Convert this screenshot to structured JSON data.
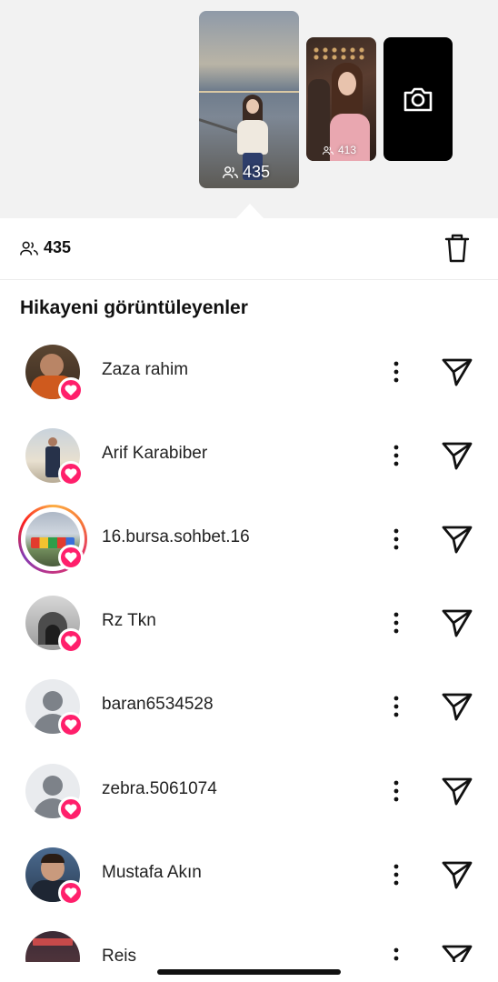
{
  "stories": {
    "main": {
      "viewers": "435",
      "icon": "people-icon"
    },
    "second": {
      "viewers": "413",
      "icon": "people-icon"
    },
    "camera": {
      "icon": "camera-icon"
    }
  },
  "summary": {
    "viewers": "435",
    "icon": "people-icon",
    "delete_icon": "trash-icon"
  },
  "section_title": "Hikayeni görüntüleyenler",
  "viewers": [
    {
      "name": "Zaza rahim",
      "avatar": "photo",
      "liked": true
    },
    {
      "name": "Arif Karabiber",
      "avatar": "photo",
      "liked": true
    },
    {
      "name": "16.bursa.sohbet.16",
      "avatar": "photo",
      "has_story_ring": true,
      "liked": true
    },
    {
      "name": "Rz Tkn",
      "avatar": "photo",
      "liked": true
    },
    {
      "name": "baran6534528",
      "avatar": "default",
      "liked": true
    },
    {
      "name": "zebra.5061074",
      "avatar": "default",
      "liked": true
    },
    {
      "name": "Mustafa Akın",
      "avatar": "photo",
      "liked": true
    },
    {
      "name": "Reis",
      "avatar": "photo",
      "liked": false
    }
  ],
  "row_icons": {
    "more": "more-vertical-icon",
    "send": "send-icon",
    "like": "heart-icon"
  },
  "colors": {
    "like_badge": "#ff1f6b",
    "background_top": "#f2f2f2",
    "text": "#111111"
  }
}
